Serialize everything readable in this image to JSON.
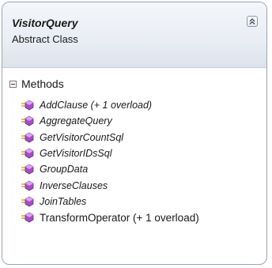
{
  "class_shape": {
    "name": "VisitorQuery",
    "stereotype": "Abstract Class"
  },
  "methods_section": {
    "title": "Methods",
    "items": [
      {
        "label": "AddClause (+ 1 overload)",
        "abstract": true
      },
      {
        "label": "AggregateQuery",
        "abstract": true
      },
      {
        "label": "GetVisitorCountSql",
        "abstract": true
      },
      {
        "label": "GetVisitorIDsSql",
        "abstract": true
      },
      {
        "label": "GroupData",
        "abstract": true
      },
      {
        "label": "InverseClauses",
        "abstract": true
      },
      {
        "label": "JoinTables",
        "abstract": true
      },
      {
        "label": "TransformOperator (+ 1 overload)",
        "abstract": false
      }
    ]
  },
  "colors": {
    "method_icon": "#a34fc4",
    "method_icon_dark": "#6e2b8f",
    "method_lines": "#e0a020"
  },
  "icons": {
    "collapse": "double-chevron-up-icon",
    "section_toggle": "minus-box-icon",
    "method": "protected-method-icon"
  }
}
